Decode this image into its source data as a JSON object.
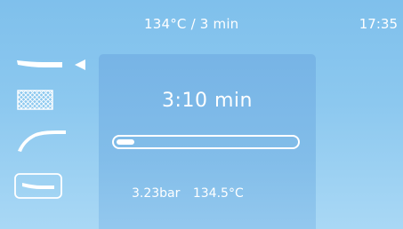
{
  "header": {
    "program": "134°C / 3 min",
    "time": "17:35"
  },
  "sidebar": {
    "items": [
      {
        "icon": "handpiece-straight-icon",
        "selected": true
      },
      {
        "icon": "mesh-tray-icon",
        "selected": false
      },
      {
        "icon": "handpiece-curved-icon",
        "selected": false
      },
      {
        "icon": "handpiece-framed-icon",
        "selected": false
      }
    ]
  },
  "cycle": {
    "remaining": "3:10 min",
    "progress_fraction": 0.1,
    "pressure": "3.23bar",
    "temperature": "134.5°C"
  },
  "colors": {
    "background_top": "#7fc0ec",
    "background_bottom": "#a9d8f5",
    "panel": "#7fbbe8",
    "foreground": "#ffffff"
  }
}
